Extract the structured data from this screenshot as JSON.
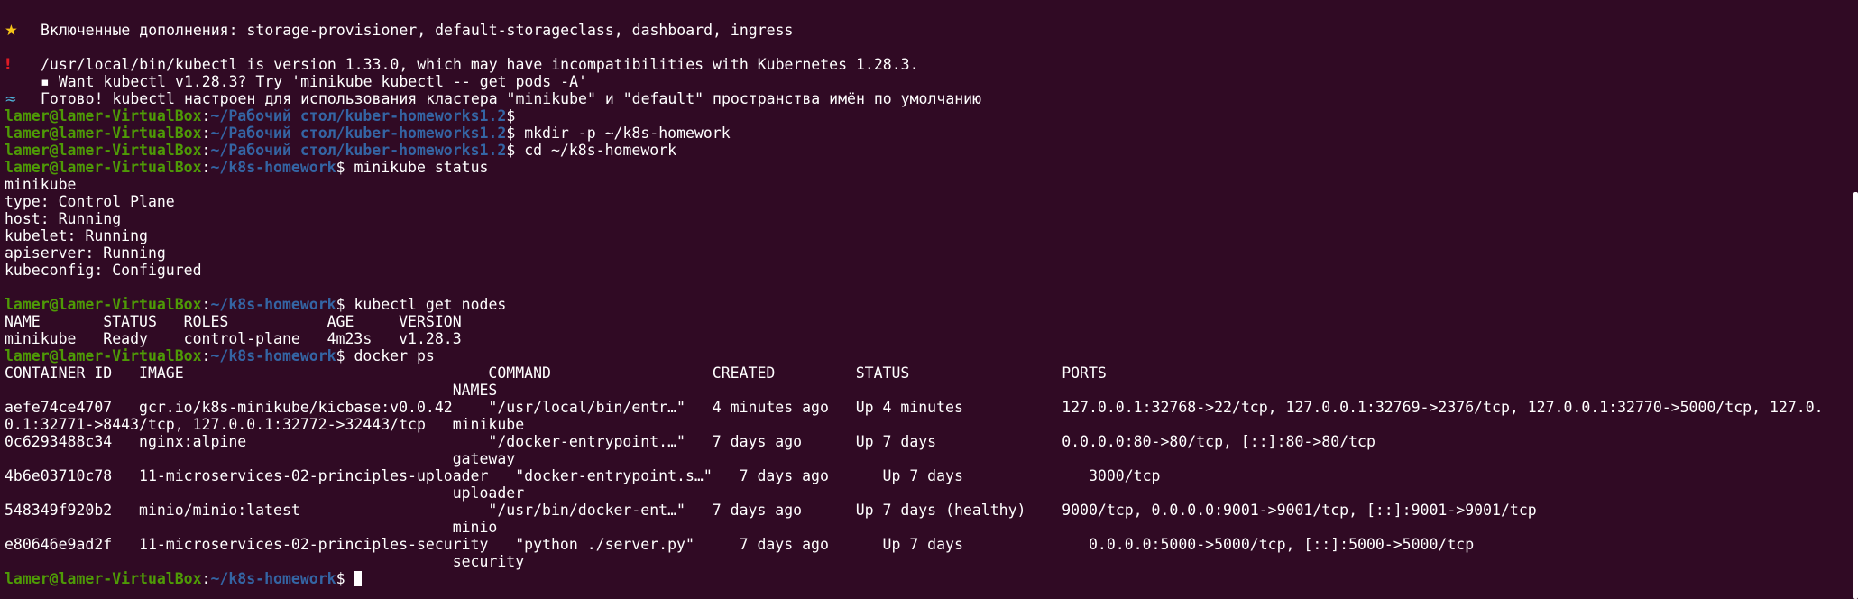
{
  "addons_line": "Включенные дополнения: storage-provisioner, default-storageclass, dashboard, ingress",
  "warning_line": "/usr/local/bin/kubectl is version 1.33.0, which may have incompatibilities with Kubernetes 1.28.3.",
  "tip_line": "▪ Want kubectl v1.28.3? Try 'minikube kubectl -- get pods -A'",
  "done_line": "Готово! kubectl настроен для использования кластера \"minikube\" и \"default\" пространства имён по умолчанию",
  "icons": {
    "star": "star-icon",
    "warning": "exclamation-icon",
    "done": "surfer-icon"
  },
  "prompt": {
    "user": "lamer@lamer-VirtualBox",
    "sep": ":",
    "path_desktop": "~/Рабочий стол/kuber-homeworks1.2",
    "path_home": "~/k8s-homework",
    "dollar": "$"
  },
  "commands": {
    "mkdir": "mkdir -p ~/k8s-homework",
    "cd": "cd ~/k8s-homework",
    "minikube_status": "minikube status",
    "get_nodes": "kubectl get nodes",
    "docker_ps": "docker ps"
  },
  "status_output": [
    "minikube",
    "type: Control Plane",
    "host: Running",
    "kubelet: Running",
    "apiserver: Running",
    "kubeconfig: Configured"
  ],
  "nodes_output": [
    "NAME       STATUS   ROLES           AGE     VERSION",
    "minikube   Ready    control-plane   4m23s   v1.28.3"
  ],
  "docker_output": [
    "CONTAINER ID   IMAGE                                  COMMAND                  CREATED         STATUS                 PORTS",
    "                                                  NAMES",
    "aefe74ce4707   gcr.io/k8s-minikube/kicbase:v0.0.42    \"/usr/local/bin/entr…\"   4 minutes ago   Up 4 minutes           127.0.0.1:32768->22/tcp, 127.0.0.1:32769->2376/tcp, 127.0.0.1:32770->5000/tcp, 127.0.",
    "0.1:32771->8443/tcp, 127.0.0.1:32772->32443/tcp   minikube",
    "0c6293488c34   nginx:alpine                           \"/docker-entrypoint.…\"   7 days ago      Up 7 days              0.0.0.0:80->80/tcp, [::]:80->80/tcp",
    "                                                  gateway",
    "4b6e03710c78   11-microservices-02-principles-uploader   \"docker-entrypoint.s…\"   7 days ago      Up 7 days              3000/tcp",
    "                                                  uploader",
    "548349f920b2   minio/minio:latest                     \"/usr/bin/docker-ent…\"   7 days ago      Up 7 days (healthy)    9000/tcp, 0.0.0.0:9001->9001/tcp, [::]:9001->9001/tcp",
    "                                                  minio",
    "e80646e9ad2f   11-microservices-02-principles-security   \"python ./server.py\"     7 days ago      Up 7 days              0.0.0.0:5000->5000/tcp, [::]:5000->5000/tcp",
    "                                                  security"
  ]
}
